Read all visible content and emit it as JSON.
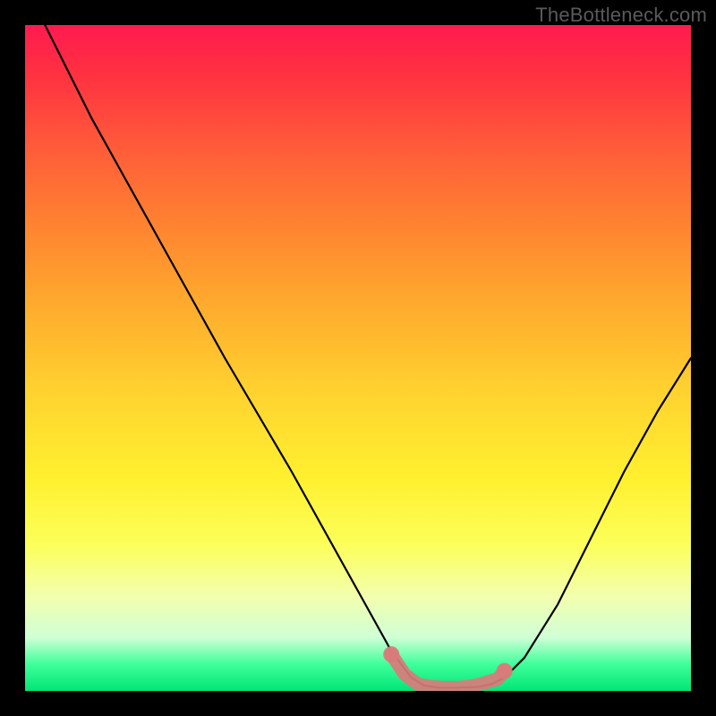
{
  "watermark": "TheBottleneck.com",
  "chart_data": {
    "type": "line",
    "title": "",
    "xlabel": "",
    "ylabel": "",
    "xlim": [
      0,
      100
    ],
    "ylim": [
      0,
      100
    ],
    "grid": false,
    "legend": false,
    "series": [
      {
        "name": "bottleneck-curve",
        "color": "#000000",
        "x": [
          3,
          10,
          20,
          30,
          40,
          50,
          55,
          58,
          60,
          62,
          65,
          68,
          70,
          72,
          75,
          80,
          85,
          90,
          95,
          100
        ],
        "y": [
          100,
          86,
          68,
          50,
          33,
          15,
          6,
          2,
          0.8,
          0.5,
          0.5,
          0.6,
          1,
          2,
          5,
          13,
          23,
          33,
          42,
          50
        ]
      }
    ],
    "markers": [
      {
        "name": "bottleneck-zone",
        "color": "#d97b7b",
        "shape": "rounded-dots",
        "x": [
          55,
          57,
          59,
          61,
          63,
          65,
          67,
          69,
          71,
          72
        ],
        "y": [
          5.5,
          2.5,
          1.0,
          0.6,
          0.5,
          0.5,
          0.7,
          1.2,
          1.8,
          3.0
        ]
      }
    ],
    "background_gradient": {
      "direction": "vertical",
      "stops": [
        {
          "pos": 0.0,
          "color": "#ff1a4f"
        },
        {
          "pos": 0.3,
          "color": "#ff8330"
        },
        {
          "pos": 0.6,
          "color": "#ffe62f"
        },
        {
          "pos": 0.9,
          "color": "#d4ffc0"
        },
        {
          "pos": 1.0,
          "color": "#00e676"
        }
      ]
    }
  }
}
